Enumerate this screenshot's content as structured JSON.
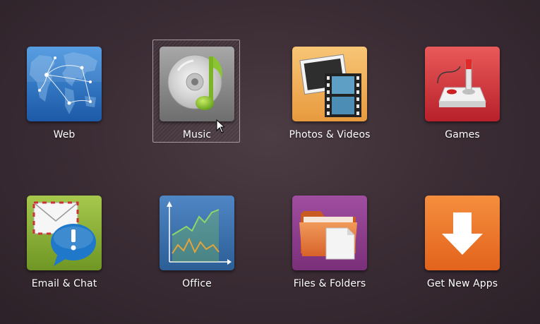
{
  "launcher": {
    "items": [
      {
        "label": "Web",
        "icon": "globe-network-icon",
        "color": "#2f74c2"
      },
      {
        "label": "Music",
        "icon": "music-cd-icon",
        "color": "#8c8c8c",
        "selected": true
      },
      {
        "label": "Photos & Videos",
        "icon": "photos-film-icon",
        "color": "#f0b05a"
      },
      {
        "label": "Games",
        "icon": "joystick-icon",
        "color": "#d43a3f"
      },
      {
        "label": "Email & Chat",
        "icon": "email-chat-icon",
        "color": "#8fb43a"
      },
      {
        "label": "Office",
        "icon": "chart-document-icon",
        "color": "#3b6fa8"
      },
      {
        "label": "Files & Folders",
        "icon": "folder-file-icon",
        "color": "#8e3d8d"
      },
      {
        "label": "Get New Apps",
        "icon": "download-arrow-icon",
        "color": "#ee7425"
      }
    ]
  }
}
